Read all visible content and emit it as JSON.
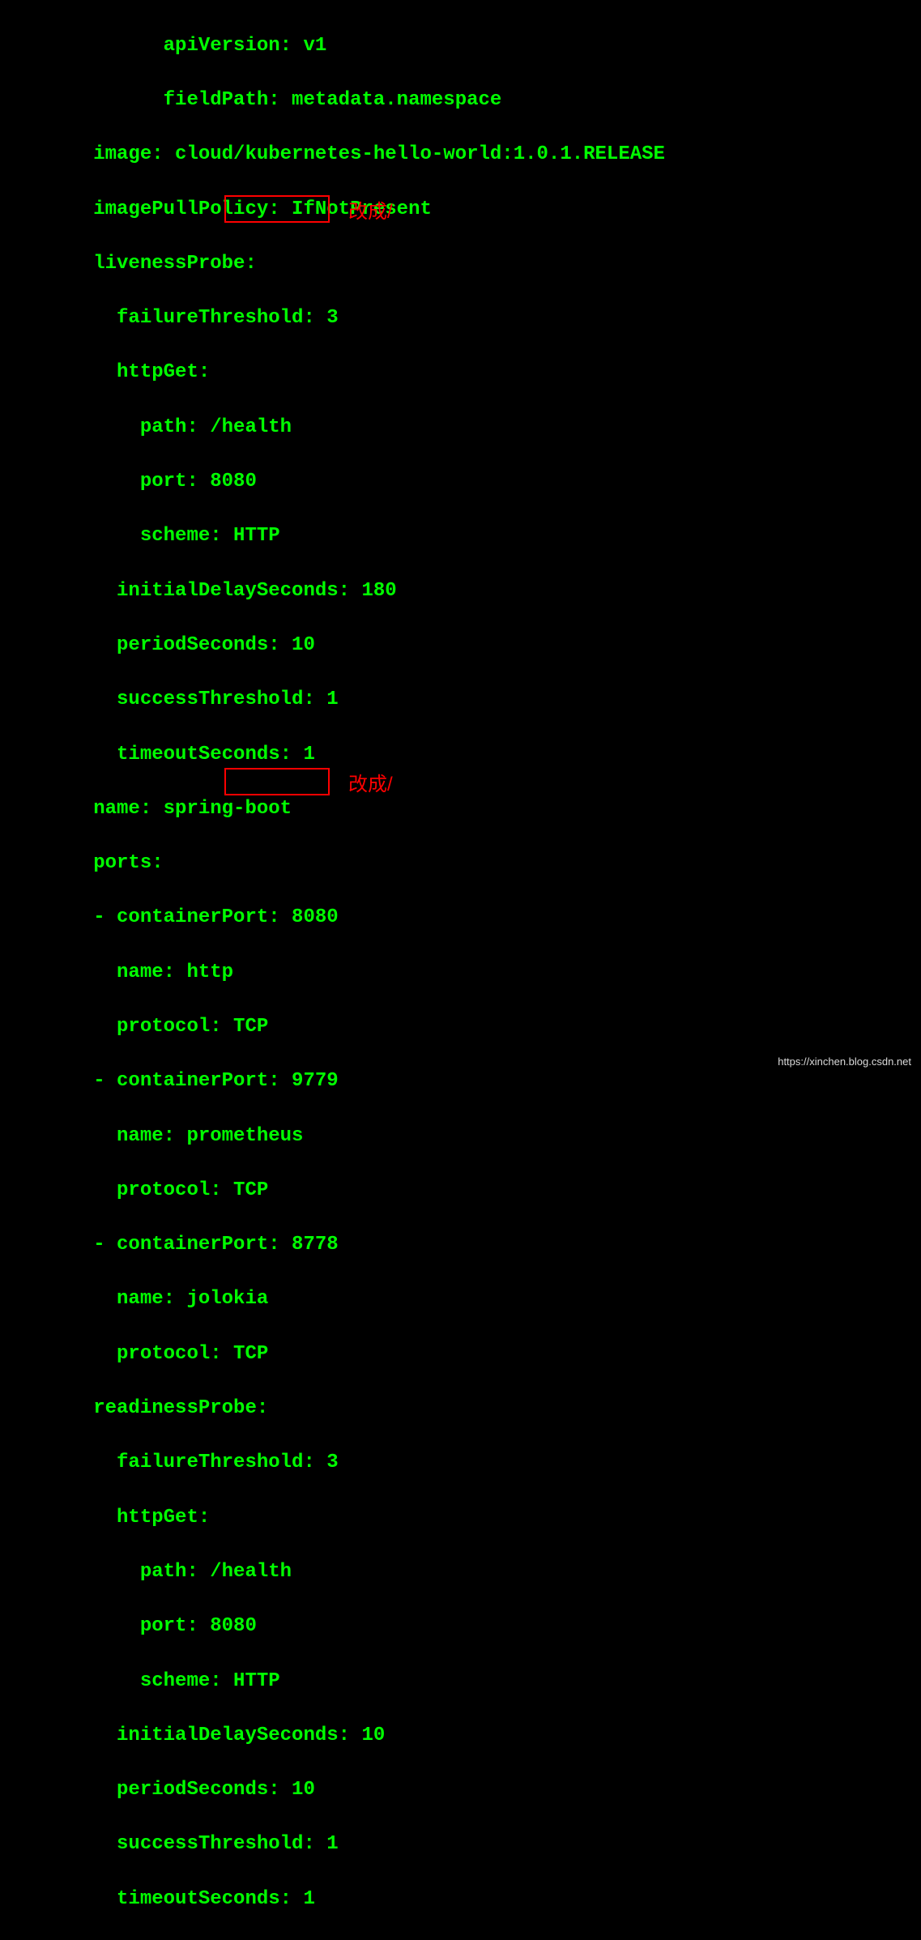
{
  "lines": {
    "l1": "          apiVersion: v1",
    "l2": "          fieldPath: metadata.namespace",
    "l3": "    image: cloud/kubernetes-hello-world:1.0.1.RELEASE",
    "l4": "    imagePullPolicy: IfNotPresent",
    "l5": "    livenessProbe:",
    "l6": "      failureThreshold: 3",
    "l7": "      httpGet:",
    "l8": "        path: /health",
    "l9": "        port: 8080",
    "l10": "        scheme: HTTP",
    "l11": "      initialDelaySeconds: 180",
    "l12": "      periodSeconds: 10",
    "l13": "      successThreshold: 1",
    "l14": "      timeoutSeconds: 1",
    "l15": "    name: spring-boot",
    "l16": "    ports:",
    "l17": "    - containerPort: 8080",
    "l18": "      name: http",
    "l19": "      protocol: TCP",
    "l20": "    - containerPort: 9779",
    "l21": "      name: prometheus",
    "l22": "      protocol: TCP",
    "l23": "    - containerPort: 8778",
    "l24": "      name: jolokia",
    "l25": "      protocol: TCP",
    "l26": "    readinessProbe:",
    "l27": "      failureThreshold: 3",
    "l28": "      httpGet:",
    "l29": "        path: /health",
    "l30": "        port: 8080",
    "l31": "        scheme: HTTP",
    "l32": "      initialDelaySeconds: 10",
    "l33": "      periodSeconds: 10",
    "l34": "      successThreshold: 1",
    "l35": "      timeoutSeconds: 1"
  },
  "annotations": {
    "a1": "改成/",
    "a2": "改成/"
  },
  "watermark": "https://xinchen.blog.csdn.net",
  "indent_prefix": "    "
}
